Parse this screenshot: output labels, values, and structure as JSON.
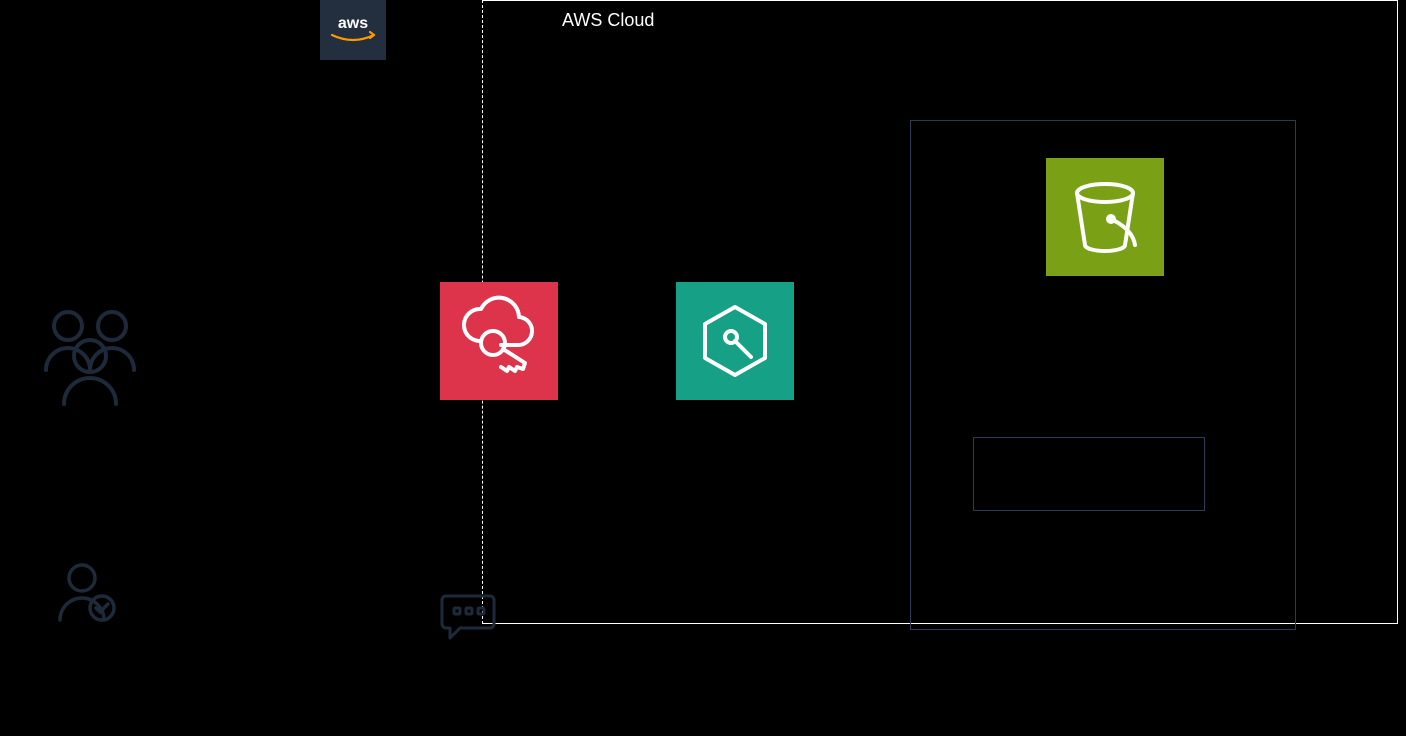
{
  "cloud_label": "AWS Cloud",
  "aws_brand_text": "aws",
  "icons": {
    "users": "users-group-icon",
    "user_check": "user-check-icon",
    "iam": "cloud-key-icon",
    "hex": "hexagon-node-icon",
    "s3": "bucket-icon",
    "chat": "chat-ellipsis-icon",
    "aws": "aws-logo-icon"
  },
  "colors": {
    "iam_tile": "#DD344C",
    "teal_tile": "#16A085",
    "s3_tile": "#7AA116",
    "aws_tile": "#232F3E",
    "panel_border": "#2B3A55",
    "stroke_dark": "#1E2A3A",
    "stroke_light": "#FFFFFF"
  }
}
